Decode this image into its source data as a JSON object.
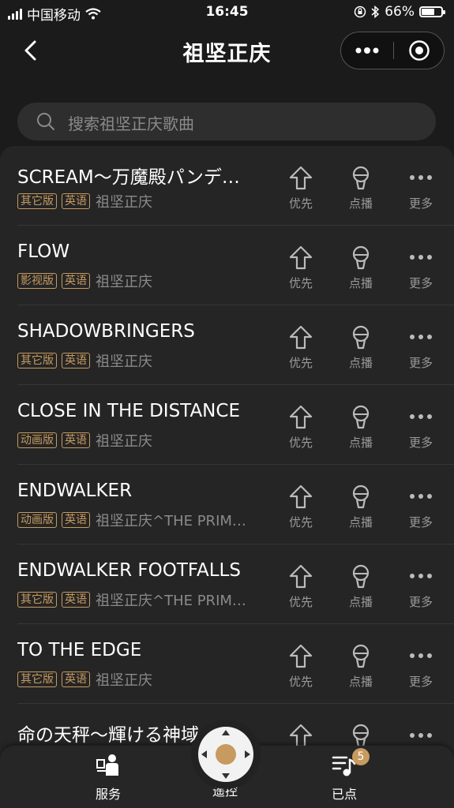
{
  "status": {
    "carrier": "中国移动",
    "time": "16:45",
    "battery": "66%",
    "battery_level": 0.66
  },
  "nav": {
    "title": "祖坚正庆"
  },
  "search": {
    "placeholder": "搜索祖坚正庆歌曲"
  },
  "actions": {
    "priority": "优先",
    "play": "点播",
    "more": "更多"
  },
  "songs": [
    {
      "title": "SCREAM～万魔殿パンデ…",
      "tags": [
        "其它版",
        "英语"
      ],
      "artist": "祖坚正庆"
    },
    {
      "title": "FLOW",
      "tags": [
        "影视版",
        "英语"
      ],
      "artist": "祖坚正庆"
    },
    {
      "title": "SHADOWBRINGERS",
      "tags": [
        "其它版",
        "英语"
      ],
      "artist": "祖坚正庆"
    },
    {
      "title": "CLOSE IN THE DISTANCE",
      "tags": [
        "动画版",
        "英语"
      ],
      "artist": "祖坚正庆"
    },
    {
      "title": "ENDWALKER",
      "tags": [
        "动画版",
        "英语"
      ],
      "artist": "祖坚正庆^THE PRIM…"
    },
    {
      "title": "ENDWALKER FOOTFALLS",
      "tags": [
        "其它版",
        "英语"
      ],
      "artist": "祖坚正庆^THE PRIM…"
    },
    {
      "title": "TO THE EDGE",
      "tags": [
        "其它版",
        "英语"
      ],
      "artist": "祖坚正庆"
    },
    {
      "title": "命の天秤～輝ける神域",
      "tags": [],
      "artist": ""
    }
  ],
  "tabbar": {
    "service": "服务",
    "remote": "遥控",
    "queue": "已点",
    "queue_count": "5"
  },
  "colors": {
    "accent": "#c79a5f",
    "background": "#1b1b1b",
    "list_bg": "#252525"
  }
}
